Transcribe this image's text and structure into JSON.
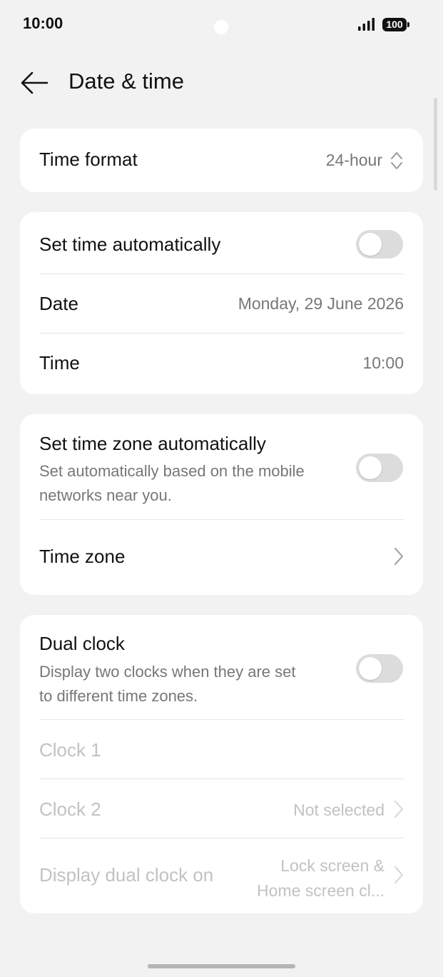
{
  "status_bar": {
    "time": "10:00",
    "battery": "100",
    "icons": [
      "signal-icon",
      "battery-icon"
    ]
  },
  "header": {
    "title": "Date & time",
    "back_icon": "arrow-left-icon"
  },
  "card_format": {
    "time_format_label": "Time format",
    "time_format_value": "24-hour"
  },
  "card_time": {
    "auto_time_label": "Set time automatically",
    "auto_time_enabled": false,
    "date_label": "Date",
    "date_value": "Monday, 29 June 2026",
    "time_label": "Time",
    "time_value": "10:00"
  },
  "card_zone": {
    "auto_zone_label": "Set time zone automatically",
    "auto_zone_sub_line1": "Set automatically based on the mobile",
    "auto_zone_sub_line2": "networks near you.",
    "auto_zone_enabled": false,
    "time_zone_label": "Time zone"
  },
  "card_dual": {
    "dual_label": "Dual clock",
    "dual_sub_line1": "Display two clocks when they are set",
    "dual_sub_line2": "to different time zones.",
    "dual_enabled": false,
    "clock1_label": "Clock 1",
    "clock2_label": "Clock 2",
    "clock2_value": "Not selected",
    "display_on_label": "Display dual clock on",
    "display_on_value_line1": "Lock screen &",
    "display_on_value_line2": "Home screen cl..."
  },
  "colors": {
    "background": "#f2f2f2",
    "card": "#ffffff",
    "secondary_text": "#777777",
    "disabled_text": "#c2c2c2",
    "toggle_off": "#dcdcdc"
  }
}
